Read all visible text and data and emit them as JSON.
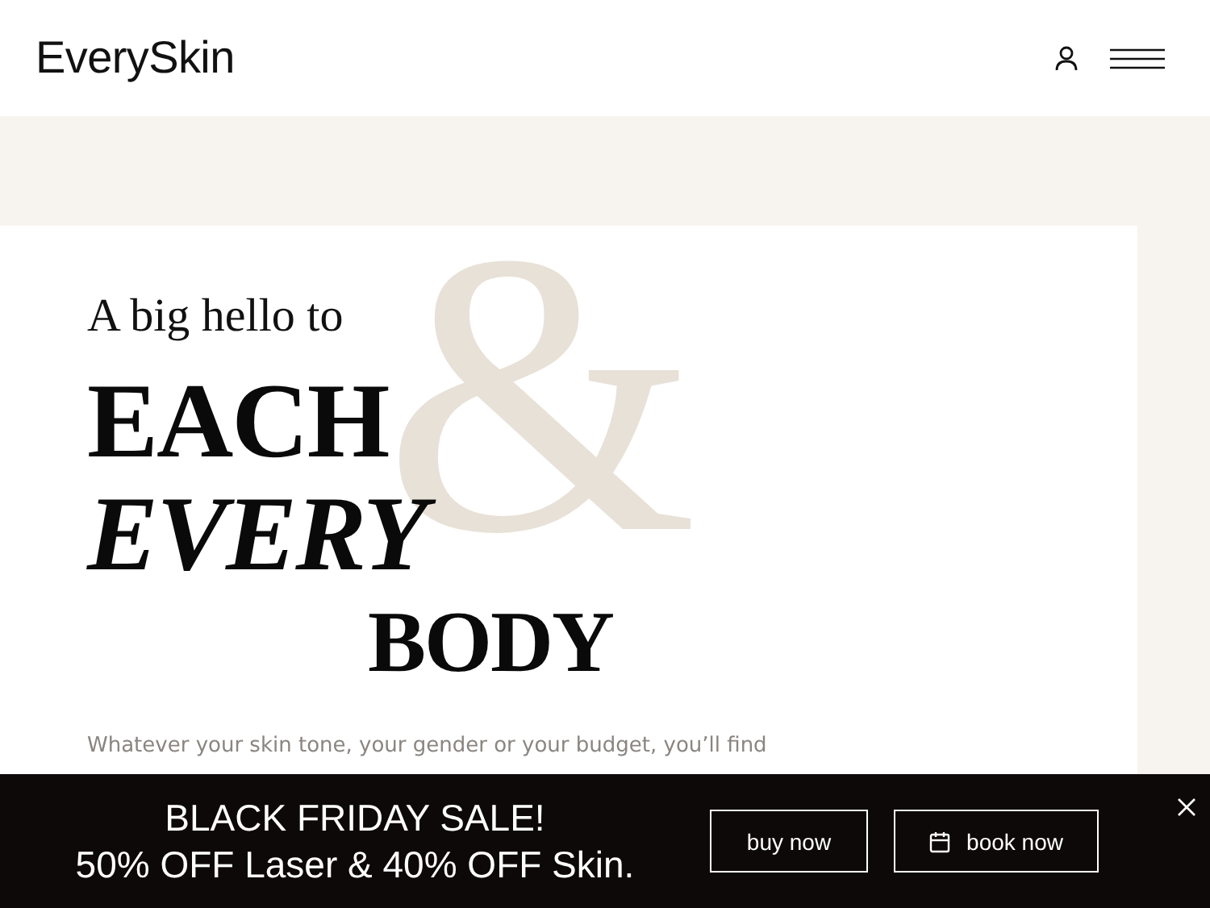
{
  "header": {
    "logo": "EverySkin"
  },
  "hero": {
    "intro": "A big hello to",
    "ampersand": "&",
    "line_1": "EACH",
    "line_2": "EVERY",
    "line_3": "BODY",
    "paragraph": "Whatever your skin tone, your gender or your budget, you’ll find"
  },
  "banner": {
    "headline": "BLACK FRIDAY SALE!",
    "subline": "50% OFF Laser & 40% OFF Skin.",
    "buttons": [
      {
        "label": "buy now",
        "kind": "plain"
      },
      {
        "label": "book now",
        "kind": "calendar"
      }
    ]
  }
}
